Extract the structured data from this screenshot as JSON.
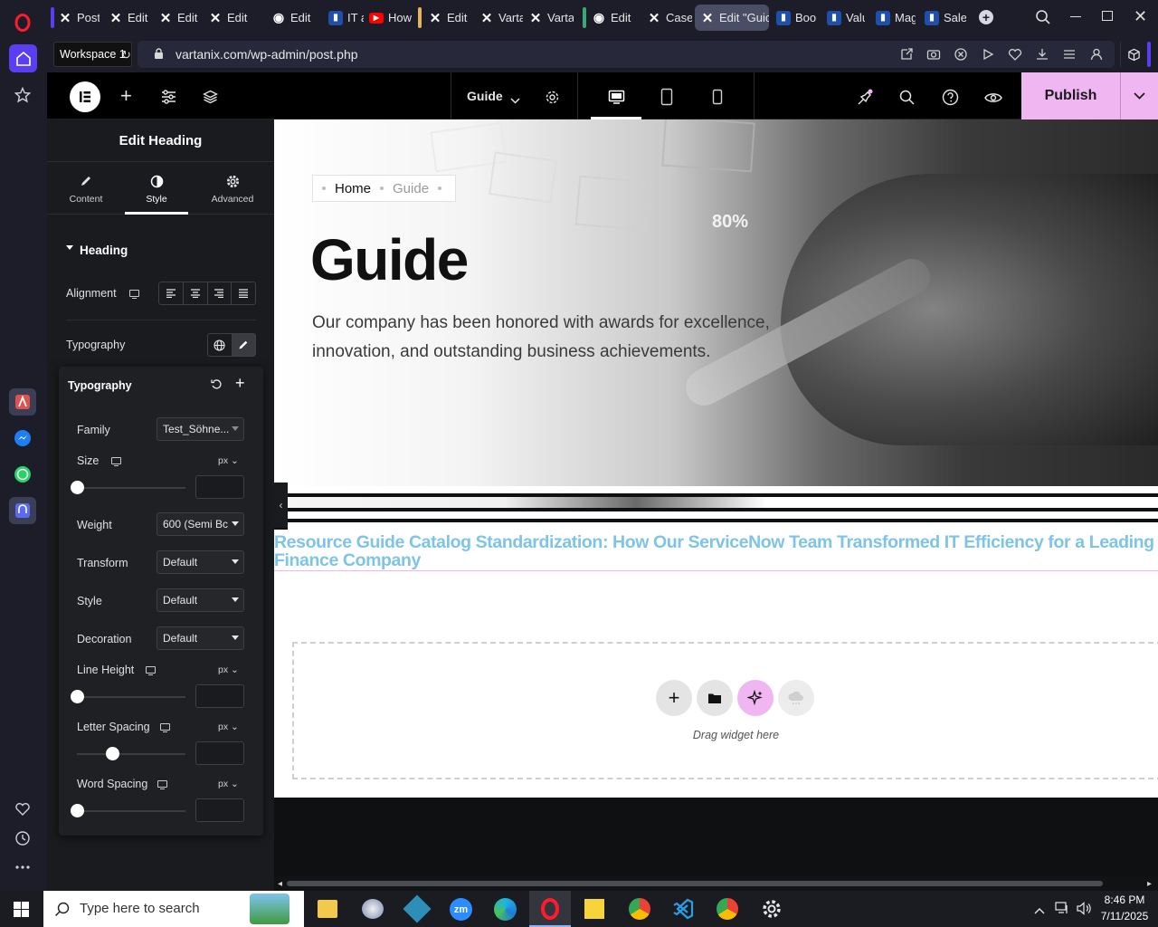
{
  "browser": {
    "workspace_tooltip": "Workspace 1",
    "url": "vartanix.com/wp-admin/post.php",
    "tabs": [
      {
        "label": "Posts",
        "icon": "x-logo",
        "active": false
      },
      {
        "label": "Edit",
        "icon": "x-logo",
        "active": false
      },
      {
        "label": "Edit",
        "icon": "x-logo",
        "active": false
      },
      {
        "label": "Edit",
        "icon": "x-logo",
        "active": false
      },
      {
        "label": "Edit",
        "icon": "globe",
        "active": false
      },
      {
        "label": "IT an",
        "icon": "bookmark",
        "active": false
      },
      {
        "label": "How",
        "icon": "youtube",
        "active": false
      },
      {
        "label": "Edit",
        "icon": "x-logo",
        "active": false
      },
      {
        "label": "Varta",
        "icon": "x-logo",
        "active": false
      },
      {
        "label": "Varta",
        "icon": "x-logo",
        "active": false
      },
      {
        "label": "Edit",
        "icon": "globe",
        "active": false
      },
      {
        "label": "Case",
        "icon": "x-logo",
        "active": false
      },
      {
        "label": "Edit \"Guic",
        "icon": "x-logo",
        "active": true
      },
      {
        "label": "Boos",
        "icon": "bookmark",
        "active": false
      },
      {
        "label": "Valu",
        "icon": "bookmark",
        "active": false
      },
      {
        "label": "Mag",
        "icon": "bookmark",
        "active": false
      },
      {
        "label": "Sales",
        "icon": "bookmark",
        "active": false
      }
    ]
  },
  "editor": {
    "page_selector": "Guide",
    "publish_label": "Publish",
    "panel_title": "Edit Heading",
    "panel_tabs": [
      {
        "label": "Content",
        "active": false
      },
      {
        "label": "Style",
        "active": true
      },
      {
        "label": "Advanced",
        "active": false
      }
    ],
    "section_heading": "Heading",
    "alignment_label": "Alignment",
    "typography_label": "Typography",
    "typography_popup": {
      "title": "Typography",
      "family_label": "Family",
      "family_value": "Test_Söhne...",
      "size_label": "Size",
      "size_unit": "px",
      "weight_label": "Weight",
      "weight_value": "600 (Semi Bc",
      "transform_label": "Transform",
      "transform_value": "Default",
      "style_label": "Style",
      "style_value": "Default",
      "decoration_label": "Decoration",
      "decoration_value": "Default",
      "line_height_label": "Line Height",
      "line_height_unit": "px",
      "letter_spacing_label": "Letter Spacing",
      "letter_spacing_unit": "px",
      "word_spacing_label": "Word Spacing",
      "word_spacing_unit": "px"
    }
  },
  "canvas": {
    "breadcrumb_home": "Home",
    "breadcrumb_current": "Guide",
    "hero_title": "Guide",
    "hero_text": "Our company has been honored with awards for excellence, innovation, and outstanding business achievements.",
    "hero_badge": "80%",
    "heading_text": "Resource Guide Catalog Standardization: How Our ServiceNow Team Transformed IT Efficiency for a Leading Finance Company",
    "drop_text": "Drag widget here"
  },
  "taskbar": {
    "search_placeholder": "Type here to search",
    "time": "8:46 PM",
    "date": "7/11/2025"
  },
  "colors": {
    "publish_bg": "#f0b6f2",
    "heading_color": "#7ec4e6",
    "active_tab_bg": "#4a4d66",
    "sidebar_bg": "#1c1d29",
    "opera_red": "#ff1b2d"
  }
}
